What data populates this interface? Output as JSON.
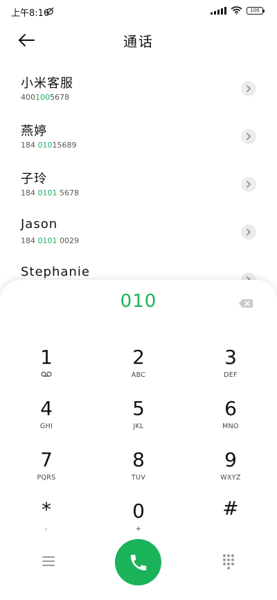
{
  "status_bar": {
    "time": "上午8:16",
    "battery": "100"
  },
  "header": {
    "title": "通话"
  },
  "contacts": [
    {
      "name": "小米客服",
      "number_pre": "400",
      "number_hl": "100",
      "number_post": "5678"
    },
    {
      "name": "燕婷",
      "number_pre": "184 ",
      "number_hl": "010",
      "number_post": "15689"
    },
    {
      "name": "子玲",
      "number_pre": "184 ",
      "number_hl": "0101",
      "number_post": " 5678"
    },
    {
      "name": "Jason",
      "number_pre": "184 ",
      "number_hl": "0101",
      "number_post": " 0029"
    },
    {
      "name": "Stephanie",
      "number_pre": "",
      "number_hl": "",
      "number_post": ""
    }
  ],
  "dialer": {
    "input": "010"
  },
  "keypad": [
    {
      "digit": "1",
      "letters": ""
    },
    {
      "digit": "2",
      "letters": "ABC"
    },
    {
      "digit": "3",
      "letters": "DEF"
    },
    {
      "digit": "4",
      "letters": "GHI"
    },
    {
      "digit": "5",
      "letters": "JKL"
    },
    {
      "digit": "6",
      "letters": "MNO"
    },
    {
      "digit": "7",
      "letters": "PQRS"
    },
    {
      "digit": "8",
      "letters": "TUV"
    },
    {
      "digit": "9",
      "letters": "WXYZ"
    },
    {
      "digit": "*",
      "letters": ","
    },
    {
      "digit": "0",
      "letters": "+"
    },
    {
      "digit": "#",
      "letters": ""
    }
  ],
  "colors": {
    "accent": "#1bb35a"
  },
  "icons": {
    "back": "arrow-left-icon",
    "chevron": "chevron-right-icon",
    "backspace": "backspace-icon",
    "voicemail": "voicemail-icon",
    "menu": "menu-icon",
    "call": "phone-icon",
    "keypad": "dialpad-icon"
  }
}
